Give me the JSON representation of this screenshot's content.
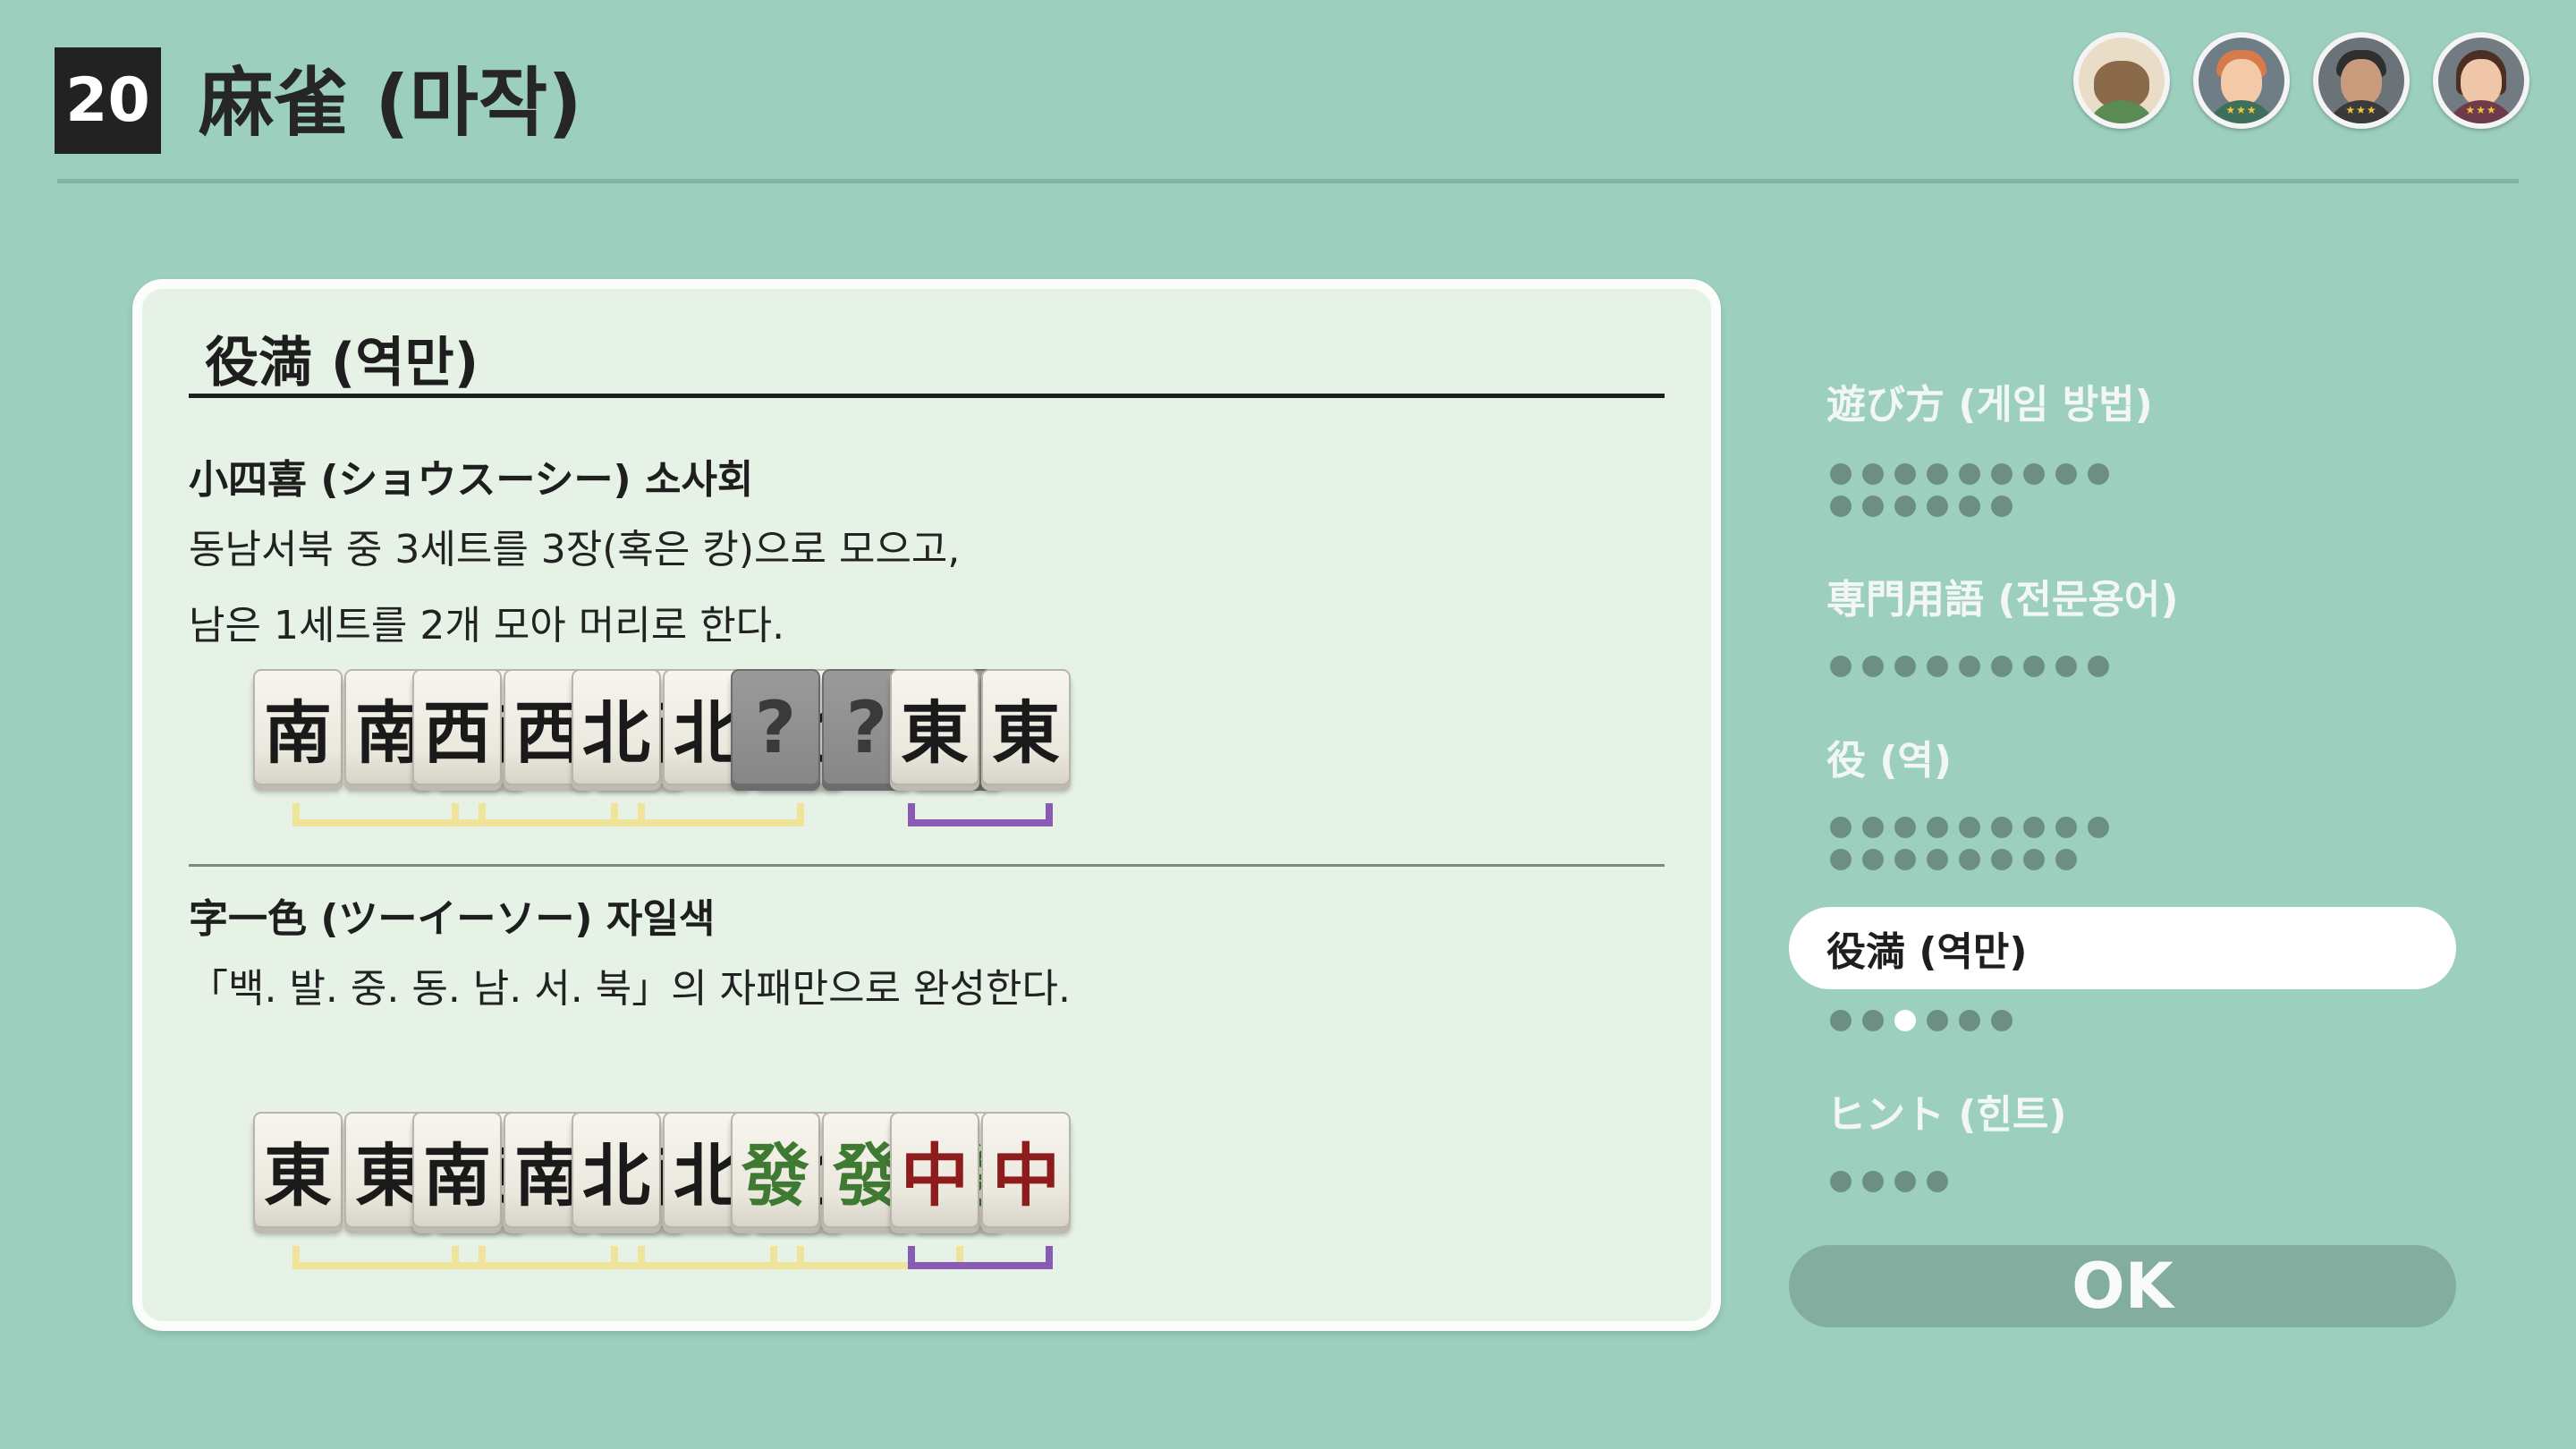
{
  "header": {
    "number": "20",
    "title": "麻雀 (마작)",
    "players": [
      {
        "name": "tanuki-avatar",
        "color": "#8b6a4a"
      },
      {
        "name": "player-2-avatar",
        "color": "#d77b4a"
      },
      {
        "name": "player-3-avatar",
        "color": "#3b3b3b"
      },
      {
        "name": "player-4-avatar",
        "color": "#5a3b2a"
      }
    ]
  },
  "panel": {
    "title": "役満 (역만)",
    "sections": [
      {
        "title": "小四喜 (ショウスーシー) 소사회",
        "lines": [
          "동남서북 중 3세트를 3장(혹은 캉)으로 모으고,",
          "남은 1세트를 2개 모아 머리로 한다."
        ],
        "groups": [
          {
            "tiles": [
              "南",
              "南",
              "南"
            ],
            "kind": "set"
          },
          {
            "tiles": [
              "西",
              "西",
              "西"
            ],
            "kind": "set"
          },
          {
            "tiles": [
              "北",
              "北",
              "北"
            ],
            "kind": "set"
          },
          {
            "tiles": [
              "?",
              "?",
              "?"
            ],
            "kind": "unknown"
          },
          {
            "tiles": [
              "東",
              "東"
            ],
            "kind": "pair"
          }
        ]
      },
      {
        "title": "字一色 (ツーイーソー) 자일색",
        "lines": [
          "「백. 발. 중. 동. 남. 서. 북」의 자패만으로 완성한다."
        ],
        "groups": [
          {
            "tiles": [
              "東",
              "東",
              "東"
            ],
            "kind": "set"
          },
          {
            "tiles": [
              "南",
              "南",
              "南"
            ],
            "kind": "set"
          },
          {
            "tiles": [
              "北",
              "北",
              "北"
            ],
            "kind": "set"
          },
          {
            "tiles": [
              "發",
              "發",
              "發"
            ],
            "kind": "set",
            "color": "green"
          },
          {
            "tiles": [
              "中",
              "中"
            ],
            "kind": "pair",
            "color": "red"
          }
        ]
      }
    ]
  },
  "sidebar": {
    "items": [
      {
        "label": "遊び方 (게임 방법)",
        "dots": 15,
        "current": -1
      },
      {
        "label": "専門用語 (전문용어)",
        "dots": 9,
        "current": -1
      },
      {
        "label": "役 (역)",
        "dots": 17,
        "current": -1
      },
      {
        "label": "役満 (역만)",
        "dots": 6,
        "current": 2,
        "active": true
      },
      {
        "label": "ヒント (힌트)",
        "dots": 4,
        "current": -1
      }
    ],
    "ok_label": "OK"
  },
  "colors": {
    "background": "#9dcfbf",
    "panel": "#e6f2e6",
    "set_bracket": "#f0e49a",
    "pair_bracket": "#8a5bb5"
  }
}
